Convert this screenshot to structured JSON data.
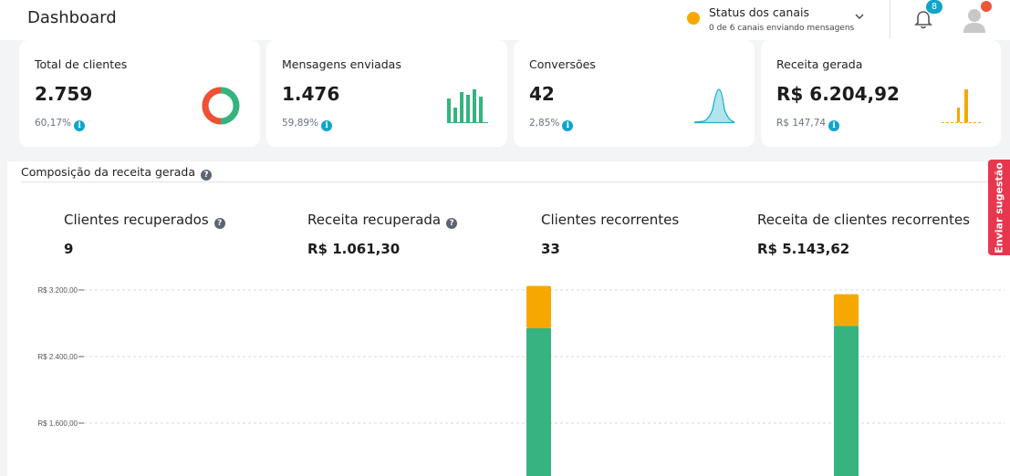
{
  "header": {
    "title": "Dashboard",
    "status": {
      "title": "Status dos canais",
      "subtitle": "0 de 6 canais enviando mensagens",
      "dot_color": "#f7a800"
    },
    "notifications": {
      "count": "8",
      "badge_color": "#0ea5c9",
      "icon": "bell-icon"
    },
    "avatar": {
      "icon": "user-avatar-icon",
      "dot_color": "#f0553a"
    }
  },
  "cards": [
    {
      "label": "Total de clientes",
      "value": "2.759",
      "percent": "60,17%",
      "icon": "donut-chart-icon"
    },
    {
      "label": "Mensagens enviadas",
      "value": "1.476",
      "percent": "59,89%",
      "icon": "bar-sparkline-icon"
    },
    {
      "label": "Conversões",
      "value": "42",
      "percent": "2,85%",
      "icon": "area-sparkline-icon"
    },
    {
      "label": "Receita gerada",
      "value": "R$ 6.204,92",
      "percent": "R$ 147,74",
      "icon": "bar-sparkline-icon"
    }
  ],
  "colors": {
    "info": "#0ea5c9",
    "help": "#5b6470",
    "green": "#36b37e",
    "orange": "#f7a800",
    "red": "#f05033",
    "teal": "#1cb0c9"
  },
  "composition": {
    "title": "Composição da receita gerada",
    "stats": [
      {
        "label": "Clientes recuperados",
        "value": "9",
        "help": true
      },
      {
        "label": "Receita recuperada",
        "value": "R$ 1.061,30",
        "help": true
      },
      {
        "label": "Clientes recorrentes",
        "value": "33",
        "help": false
      },
      {
        "label": "Receita de clientes recorrentes",
        "value": "R$ 5.143,62",
        "help": false
      }
    ]
  },
  "chart_data": {
    "type": "bar",
    "stacked": true,
    "title": "",
    "xlabel": "",
    "ylabel": "",
    "yticks": [
      "R$ 3.200,00",
      "R$ 2.400,00",
      "R$ 1.600,00"
    ],
    "ytick_values": [
      3200,
      2400,
      1600
    ],
    "grid": true,
    "series": [
      {
        "color": "#36b37e",
        "values": [
          2740,
          2770
        ]
      },
      {
        "color": "#f7a800",
        "values": [
          510,
          380
        ]
      }
    ]
  },
  "feedback": {
    "label": "Enviar sugestão",
    "color": "#e8364e"
  }
}
